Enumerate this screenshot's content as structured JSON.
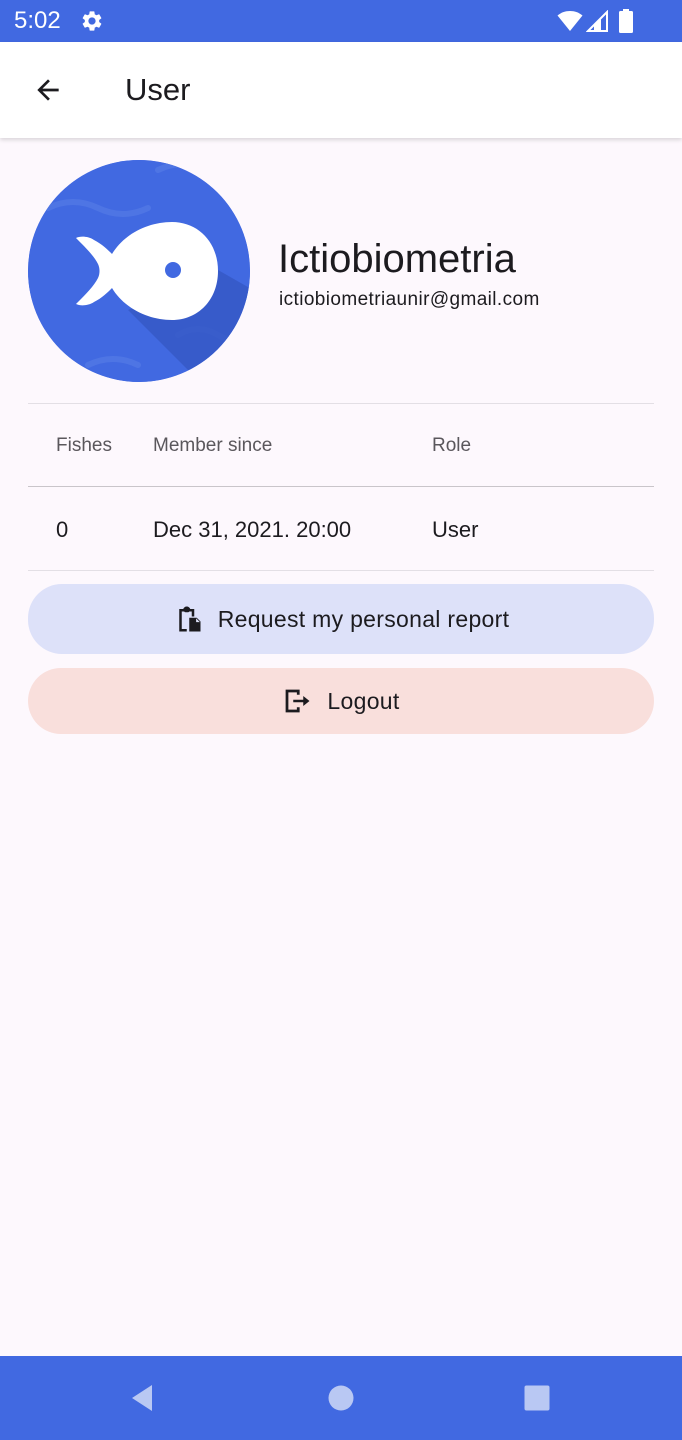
{
  "status_bar": {
    "time": "5:02",
    "icons": [
      "gear-icon",
      "wifi-icon",
      "signal-icon",
      "battery-icon"
    ]
  },
  "app_bar": {
    "title": "User",
    "back_icon": "arrow-back-icon"
  },
  "profile": {
    "name": "Ictiobiometria",
    "email": "ictiobiometriaunir@gmail.com",
    "avatar_icon": "fish-icon"
  },
  "stats_table": {
    "headers": [
      "Fishes",
      "Member since",
      "Role"
    ],
    "row": [
      "0",
      "Dec 31, 2021. 20:00",
      "User"
    ]
  },
  "actions": {
    "report_label": "Request my personal report",
    "report_icon": "clipboard-file-icon",
    "logout_label": "Logout",
    "logout_icon": "logout-icon"
  },
  "nav_bar": {
    "icons": [
      "back-triangle-icon",
      "home-circle-icon",
      "recents-square-icon"
    ]
  },
  "colors": {
    "primary": "#4169e1",
    "background": "#fdf8fd",
    "report_button": "#dde1f9",
    "logout_button": "#f9dfdc",
    "text": "#1c1b1f"
  }
}
